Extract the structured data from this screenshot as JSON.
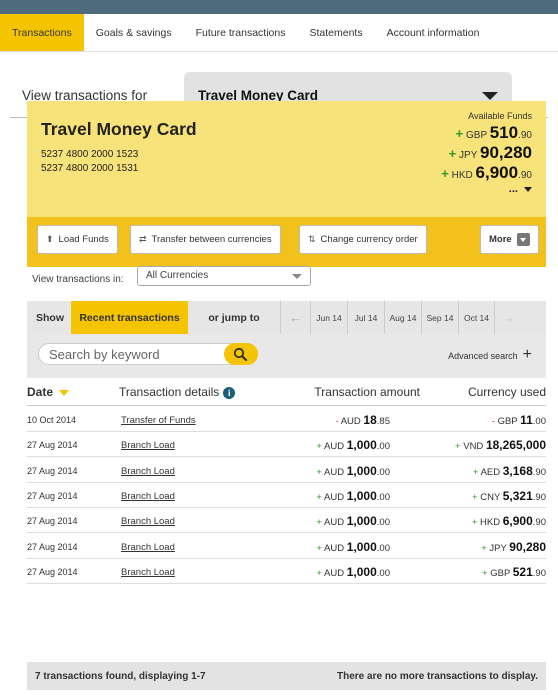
{
  "tabs": [
    "Transactions",
    "Goals & savings",
    "Future transactions",
    "Statements",
    "Account information"
  ],
  "view_for": {
    "label": "View transactions for",
    "selected": "Travel Money Card"
  },
  "card": {
    "title": "Travel Money Card",
    "numbers": [
      "5237 4800 2000 1523",
      "5237 4800 2000 1531"
    ],
    "funds_label": "Available Funds",
    "funds": [
      {
        "sign": "+",
        "currency": "GBP",
        "int": "510",
        "dec": ".90"
      },
      {
        "sign": "+",
        "currency": "JPY",
        "int": "90,280",
        "dec": ""
      },
      {
        "sign": "+",
        "currency": "HKD",
        "int": "6,900",
        "dec": ".90"
      }
    ],
    "more_funds": "...",
    "more_funds_icon": "caret-down-icon"
  },
  "actions": {
    "load_funds": "Load Funds",
    "transfer": "Transfer between currencies",
    "change_order": "Change currency order",
    "more": "More"
  },
  "currency_filter": {
    "label": "View transactions in:",
    "selected": "All Currencies"
  },
  "filter": {
    "show": "Show",
    "recent": "Recent transactions",
    "jump": "or jump to",
    "months": [
      "Jun 14",
      "Jul 14",
      "Aug 14",
      "Sep 14",
      "Oct 14"
    ]
  },
  "search": {
    "placeholder": "Search by keyword",
    "advanced": "Advanced search"
  },
  "columns": {
    "date": "Date",
    "details": "Transaction details",
    "amount": "Transaction amount",
    "currency": "Currency used"
  },
  "transactions": [
    {
      "date": "10 Oct 2014",
      "details": "Transfer of Funds",
      "amt_sign": "-",
      "amt_cur": "AUD",
      "amt_int": "18",
      "amt_dec": ".85",
      "cur_sign": "-",
      "cur_cur": "GBP",
      "cur_int": "11",
      "cur_dec": ".00"
    },
    {
      "date": "27 Aug 2014",
      "details": "Branch Load",
      "amt_sign": "+",
      "amt_cur": "AUD",
      "amt_int": "1,000",
      "amt_dec": ".00",
      "cur_sign": "+",
      "cur_cur": "VND",
      "cur_int": "18,265,000",
      "cur_dec": ""
    },
    {
      "date": "27 Aug 2014",
      "details": "Branch Load",
      "amt_sign": "+",
      "amt_cur": "AUD",
      "amt_int": "1,000",
      "amt_dec": ".00",
      "cur_sign": "+",
      "cur_cur": "AED",
      "cur_int": "3,168",
      "cur_dec": ".90"
    },
    {
      "date": "27 Aug 2014",
      "details": "Branch Load",
      "amt_sign": "+",
      "amt_cur": "AUD",
      "amt_int": "1,000",
      "amt_dec": ".00",
      "cur_sign": "+",
      "cur_cur": "CNY",
      "cur_int": "5,321",
      "cur_dec": ".90"
    },
    {
      "date": "27 Aug 2014",
      "details": "Branch Load",
      "amt_sign": "+",
      "amt_cur": "AUD",
      "amt_int": "1,000",
      "amt_dec": ".00",
      "cur_sign": "+",
      "cur_cur": "HKD",
      "cur_int": "6,900",
      "cur_dec": ".90"
    },
    {
      "date": "27 Aug 2014",
      "details": "Branch Load",
      "amt_sign": "+",
      "amt_cur": "AUD",
      "amt_int": "1,000",
      "amt_dec": ".00",
      "cur_sign": "+",
      "cur_cur": "JPY",
      "cur_int": "90,280",
      "cur_dec": ""
    },
    {
      "date": "27 Aug 2014",
      "details": "Branch Load",
      "amt_sign": "+",
      "amt_cur": "AUD",
      "amt_int": "1,000",
      "amt_dec": ".00",
      "cur_sign": "+",
      "cur_cur": "GBP",
      "cur_int": "521",
      "cur_dec": ".90"
    }
  ],
  "footer": {
    "found": "7 transactions found, displaying 1-7",
    "no_more": "There are no more transactions to display."
  },
  "colors": {
    "accent": "#f5c400",
    "card_bg": "#f8e27a",
    "positive": "#2c9a2c",
    "negative": "#d12f2f",
    "frame": "#4f6b7e"
  }
}
